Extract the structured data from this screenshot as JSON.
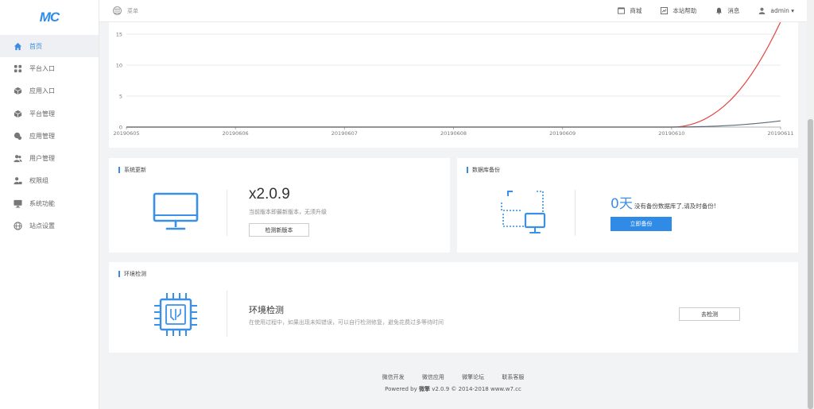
{
  "logo": {
    "text": "MC"
  },
  "sidebar": {
    "items": [
      {
        "label": "首页",
        "icon": "home-icon"
      },
      {
        "label": "平台入口",
        "icon": "grid-icon"
      },
      {
        "label": "应用入口",
        "icon": "cube-icon"
      },
      {
        "label": "平台管理",
        "icon": "cube-icon"
      },
      {
        "label": "应用管理",
        "icon": "puzzle-icon"
      },
      {
        "label": "用户管理",
        "icon": "users-icon"
      },
      {
        "label": "权限组",
        "icon": "user-lock-icon"
      },
      {
        "label": "系统功能",
        "icon": "monitor-icon"
      },
      {
        "label": "站点设置",
        "icon": "globe-icon"
      }
    ]
  },
  "topbar": {
    "menu_label": "菜单",
    "links": [
      {
        "label": "商城",
        "icon": "shop-icon"
      },
      {
        "label": "本站帮助",
        "icon": "help-icon"
      },
      {
        "label": "消息",
        "icon": "bell-icon"
      },
      {
        "label": "admin ▾",
        "icon": "user-icon"
      }
    ]
  },
  "chart_data": {
    "type": "line",
    "categories": [
      "20190605",
      "20190606",
      "20190607",
      "20190608",
      "20190609",
      "20190610",
      "20190611"
    ],
    "yticks": [
      "0",
      "5",
      "10",
      "15"
    ],
    "ylim": [
      0,
      15
    ],
    "series": [
      {
        "color": "#e0463f",
        "values": [
          0,
          0,
          0,
          0,
          0,
          0,
          17
        ]
      },
      {
        "color": "#5a6b78",
        "values": [
          0,
          0,
          0,
          0,
          0,
          0,
          1
        ]
      }
    ],
    "grid": true
  },
  "system_update": {
    "title": "系统更新",
    "version": "x2.0.9",
    "note": "当前版本即最新版本，无须升级",
    "check_button": "检测新版本"
  },
  "backup": {
    "title": "数据库备份",
    "days": "0天",
    "note": "没有备份数据库了,请及时备份!",
    "backup_button": "立即备份"
  },
  "env_check": {
    "title": "环境检测",
    "heading": "环境检测",
    "note": "在使用过程中，如果出现未知错误，可以自行检测修复，避免花费过多等待时间",
    "check_button": "去检测"
  },
  "footer": {
    "links": [
      "微信开发",
      "微信应用",
      "微擎论坛",
      "联系客服"
    ],
    "power_prefix": "Powered by",
    "brand": "微擎",
    "power_suffix": "v2.0.9 © 2014-2018 www.w7.cc"
  },
  "colors": {
    "accent": "#2f8be6"
  }
}
